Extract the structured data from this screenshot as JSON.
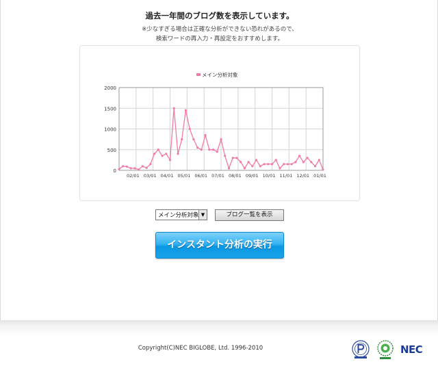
{
  "header": {
    "title": "過去一年間のブログ数を表示しています。",
    "note_line1": "※少なすぎる場合は正確な分析ができない恐れがあるので、",
    "note_line2": "検索ワードの再入力・再設定をおすすめします。"
  },
  "chart_data": {
    "type": "line",
    "title": "",
    "xlabel": "",
    "ylabel": "",
    "ylim": [
      0,
      2000
    ],
    "y_ticks": [
      "0",
      "500",
      "1000",
      "1500",
      "2000"
    ],
    "x_tick_labels": [
      "02/01",
      "03/01",
      "04/01",
      "05/01",
      "06/01",
      "07/01",
      "08/01",
      "09/01",
      "10/01",
      "11/01",
      "12/01",
      "01/01"
    ],
    "grid": true,
    "legend_position": "top-center",
    "series": [
      {
        "name": "メイン分析対象",
        "color": "#f07aa8",
        "values": [
          30,
          100,
          90,
          50,
          50,
          20,
          100,
          60,
          150,
          400,
          500,
          350,
          400,
          250,
          1500,
          400,
          750,
          1450,
          1000,
          750,
          550,
          500,
          850,
          500,
          500,
          450,
          750,
          350,
          50,
          300,
          300,
          200,
          50,
          200,
          100,
          250,
          100,
          150,
          150,
          150,
          250,
          50,
          150,
          150,
          150,
          200,
          350,
          200,
          300,
          200,
          100,
          250,
          20
        ]
      }
    ]
  },
  "controls": {
    "select_value": "メイン分析対象",
    "list_button_label": "ブログ一覧を表示",
    "run_button_label": "インスタント分析の実行"
  },
  "footer": {
    "copyright": "Copyright(C)NEC BIGLOBE, Ltd. 1996-2010",
    "nec_logo": "NEC"
  }
}
